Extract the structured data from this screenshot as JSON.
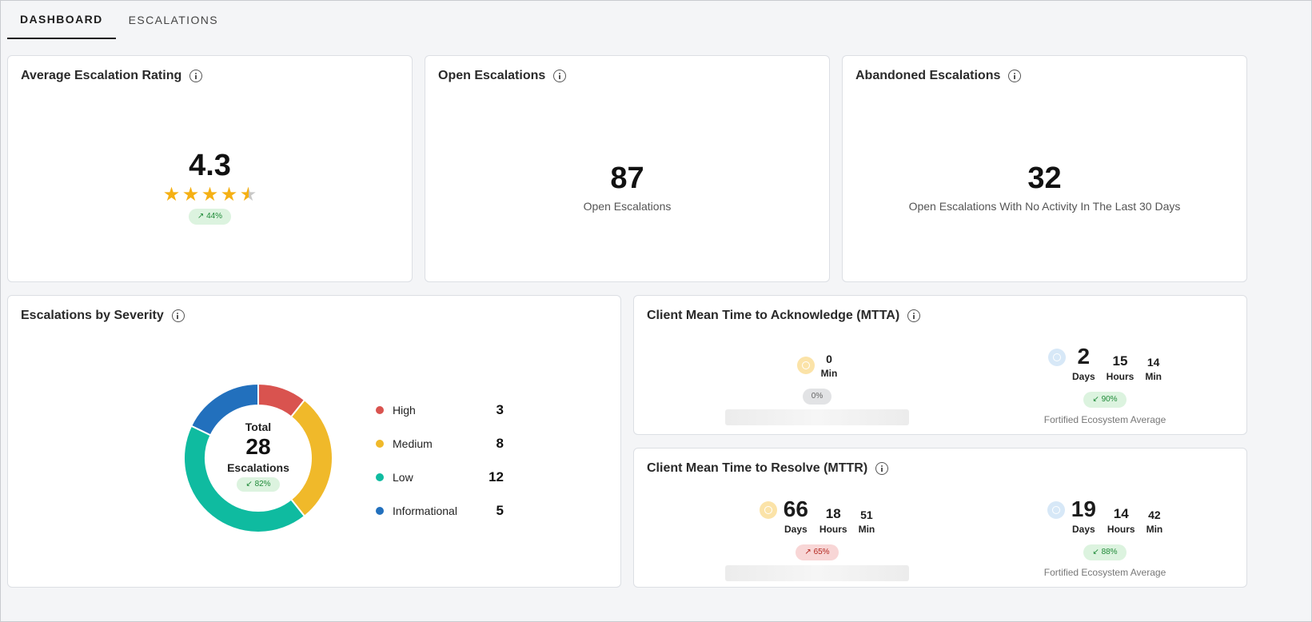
{
  "tabs": [
    {
      "label": "DASHBOARD",
      "active": true
    },
    {
      "label": "ESCALATIONS",
      "active": false
    }
  ],
  "rating": {
    "title": "Average Escalation Rating",
    "value": "4.3",
    "stars": 4.3,
    "max_stars": 5,
    "trend": "↗ 44%"
  },
  "open": {
    "title": "Open Escalations",
    "value": "87",
    "label": "Open Escalations"
  },
  "abandoned": {
    "title": "Abandoned Escalations",
    "value": "32",
    "label": "Open Escalations With No Activity In The Last 30 Days"
  },
  "severity": {
    "title": "Escalations by Severity",
    "center": {
      "heading": "Total",
      "value": "28",
      "label": "Escalations",
      "trend": "↙ 82%"
    }
  },
  "chart_data": {
    "type": "pie",
    "categories": [
      "High",
      "Medium",
      "Low",
      "Informational"
    ],
    "values": [
      3,
      8,
      12,
      5
    ],
    "colors": [
      "#d9534f",
      "#f0b92a",
      "#0fbba0",
      "#2270bd"
    ]
  },
  "mtta": {
    "title": "Client Mean Time to Acknowledge (MTTA)",
    "client": {
      "parts": [
        {
          "value": "0",
          "unit": "Min"
        }
      ],
      "trend": "0%"
    },
    "ecosystem": {
      "parts": [
        {
          "value": "2",
          "unit": "Days"
        },
        {
          "value": "15",
          "unit": "Hours"
        },
        {
          "value": "14",
          "unit": "Min"
        }
      ],
      "trend": "↙ 90%",
      "label": "Fortified Ecosystem Average"
    }
  },
  "mttr": {
    "title": "Client Mean Time to Resolve (MTTR)",
    "client": {
      "parts": [
        {
          "value": "66",
          "unit": "Days"
        },
        {
          "value": "18",
          "unit": "Hours"
        },
        {
          "value": "51",
          "unit": "Min"
        }
      ],
      "trend": "↗ 65%"
    },
    "ecosystem": {
      "parts": [
        {
          "value": "19",
          "unit": "Days"
        },
        {
          "value": "14",
          "unit": "Hours"
        },
        {
          "value": "42",
          "unit": "Min"
        }
      ],
      "trend": "↙ 88%",
      "label": "Fortified Ecosystem Average"
    }
  }
}
